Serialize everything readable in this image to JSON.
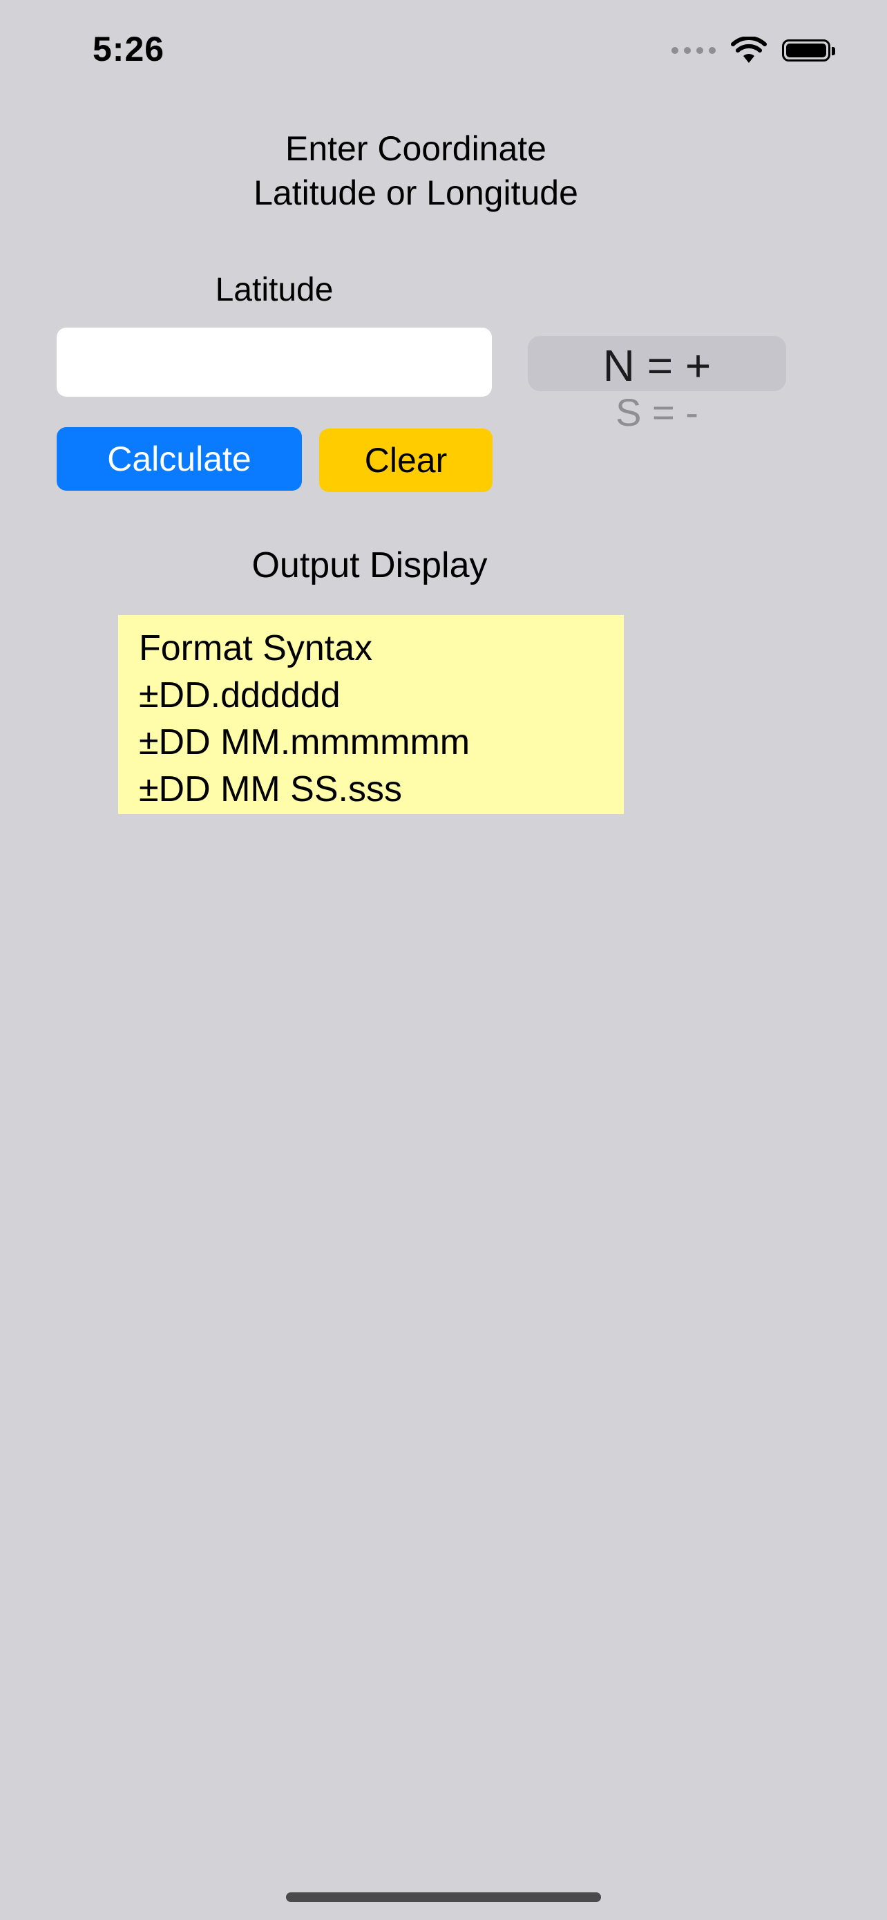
{
  "status_bar": {
    "time": "5:26",
    "icons": [
      "cellular-signal-icon",
      "wifi-icon",
      "battery-icon"
    ]
  },
  "header": {
    "line1": "Enter Coordinate",
    "line2": "Latitude or Longitude"
  },
  "input": {
    "label": "Latitude",
    "value": "",
    "placeholder": ""
  },
  "hemisphere_picker": {
    "options": [
      "N = +",
      "S = -",
      "…"
    ],
    "selected": "N = +"
  },
  "buttons": {
    "calculate": "Calculate",
    "clear": "Clear"
  },
  "output": {
    "label": "Output Display",
    "lines": [
      "Format Syntax",
      "±DD.dddddd",
      "±DD MM.mmmmmm",
      "±DD MM SS.sss"
    ]
  },
  "colors": {
    "background": "#d2d2d7",
    "calculate_button": "#0a7aff",
    "clear_button": "#ffcc00",
    "output_background": "#fffcaa"
  }
}
